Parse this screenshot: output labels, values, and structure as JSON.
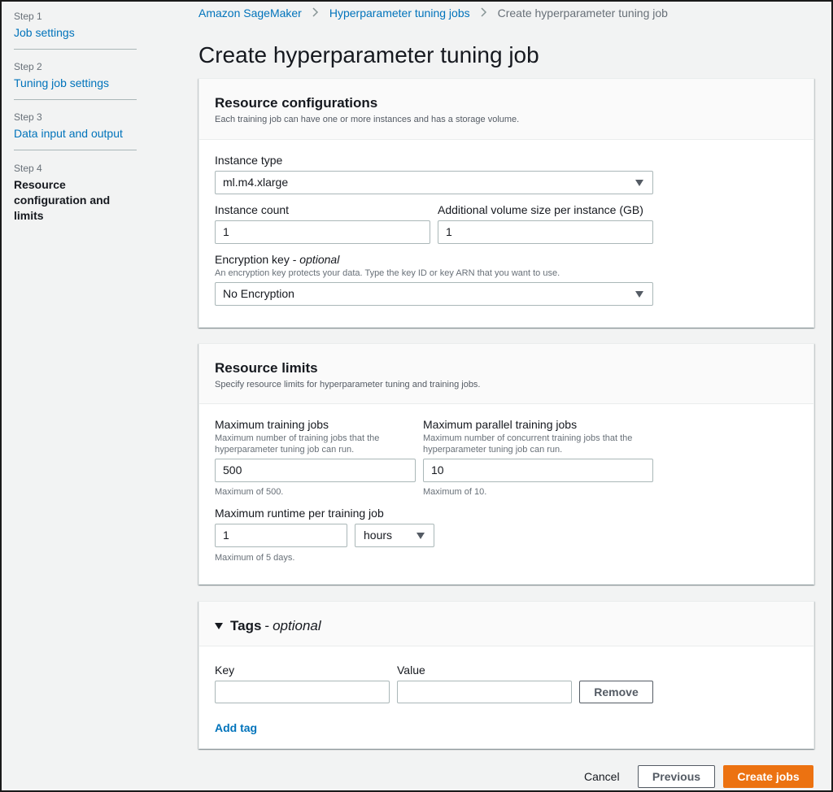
{
  "sidebar": {
    "steps": [
      {
        "num": "Step 1",
        "label": "Job settings"
      },
      {
        "num": "Step 2",
        "label": "Tuning job settings"
      },
      {
        "num": "Step 3",
        "label": "Data input and output"
      },
      {
        "num": "Step 4",
        "label": "Resource configuration and limits"
      }
    ]
  },
  "breadcrumb": {
    "items": [
      "Amazon SageMaker",
      "Hyperparameter tuning jobs",
      "Create hyperparameter tuning job"
    ],
    "separator": ">"
  },
  "page_title": "Create hyperparameter tuning job",
  "resource_config": {
    "title": "Resource configurations",
    "description": "Each training job can have one or more instances and has a storage volume.",
    "instance_type_label": "Instance type",
    "instance_type_value": "ml.m4.xlarge",
    "instance_count_label": "Instance count",
    "instance_count_value": "1",
    "volume_size_label": "Additional volume size per instance (GB)",
    "volume_size_value": "1",
    "encryption_label": "Encryption key",
    "encryption_optional": "optional",
    "encryption_hint": "An encryption key protects your data. Type the key ID or key ARN that you want to use.",
    "encryption_value": "No Encryption"
  },
  "resource_limits": {
    "title": "Resource limits",
    "description": "Specify resource limits for hyperparameter tuning and training jobs.",
    "max_training_label": "Maximum training jobs",
    "max_training_hint": "Maximum number of training jobs that the hyperparameter tuning job can run.",
    "max_training_value": "500",
    "max_training_constraint": "Maximum of 500.",
    "max_parallel_label": "Maximum parallel training jobs",
    "max_parallel_hint": "Maximum number of concurrent training jobs that the hyperparameter tuning job can run.",
    "max_parallel_value": "10",
    "max_parallel_constraint": "Maximum of 10.",
    "max_runtime_label": "Maximum runtime per training job",
    "max_runtime_value": "1",
    "max_runtime_unit": "hours",
    "max_runtime_constraint": "Maximum of 5 days."
  },
  "tags": {
    "title": "Tags",
    "optional": "optional",
    "key_label": "Key",
    "value_label": "Value",
    "key_value": "",
    "value_value": "",
    "remove_label": "Remove",
    "add_tag_label": "Add tag"
  },
  "footer": {
    "cancel_label": "Cancel",
    "previous_label": "Previous",
    "create_label": "Create jobs"
  },
  "colors": {
    "link": "#0073bb",
    "primary_button": "#ec7211",
    "background": "#f2f3f3"
  },
  "icons": [
    "chevron-right-icon",
    "caret-down-icon",
    "triangle-down-icon"
  ]
}
